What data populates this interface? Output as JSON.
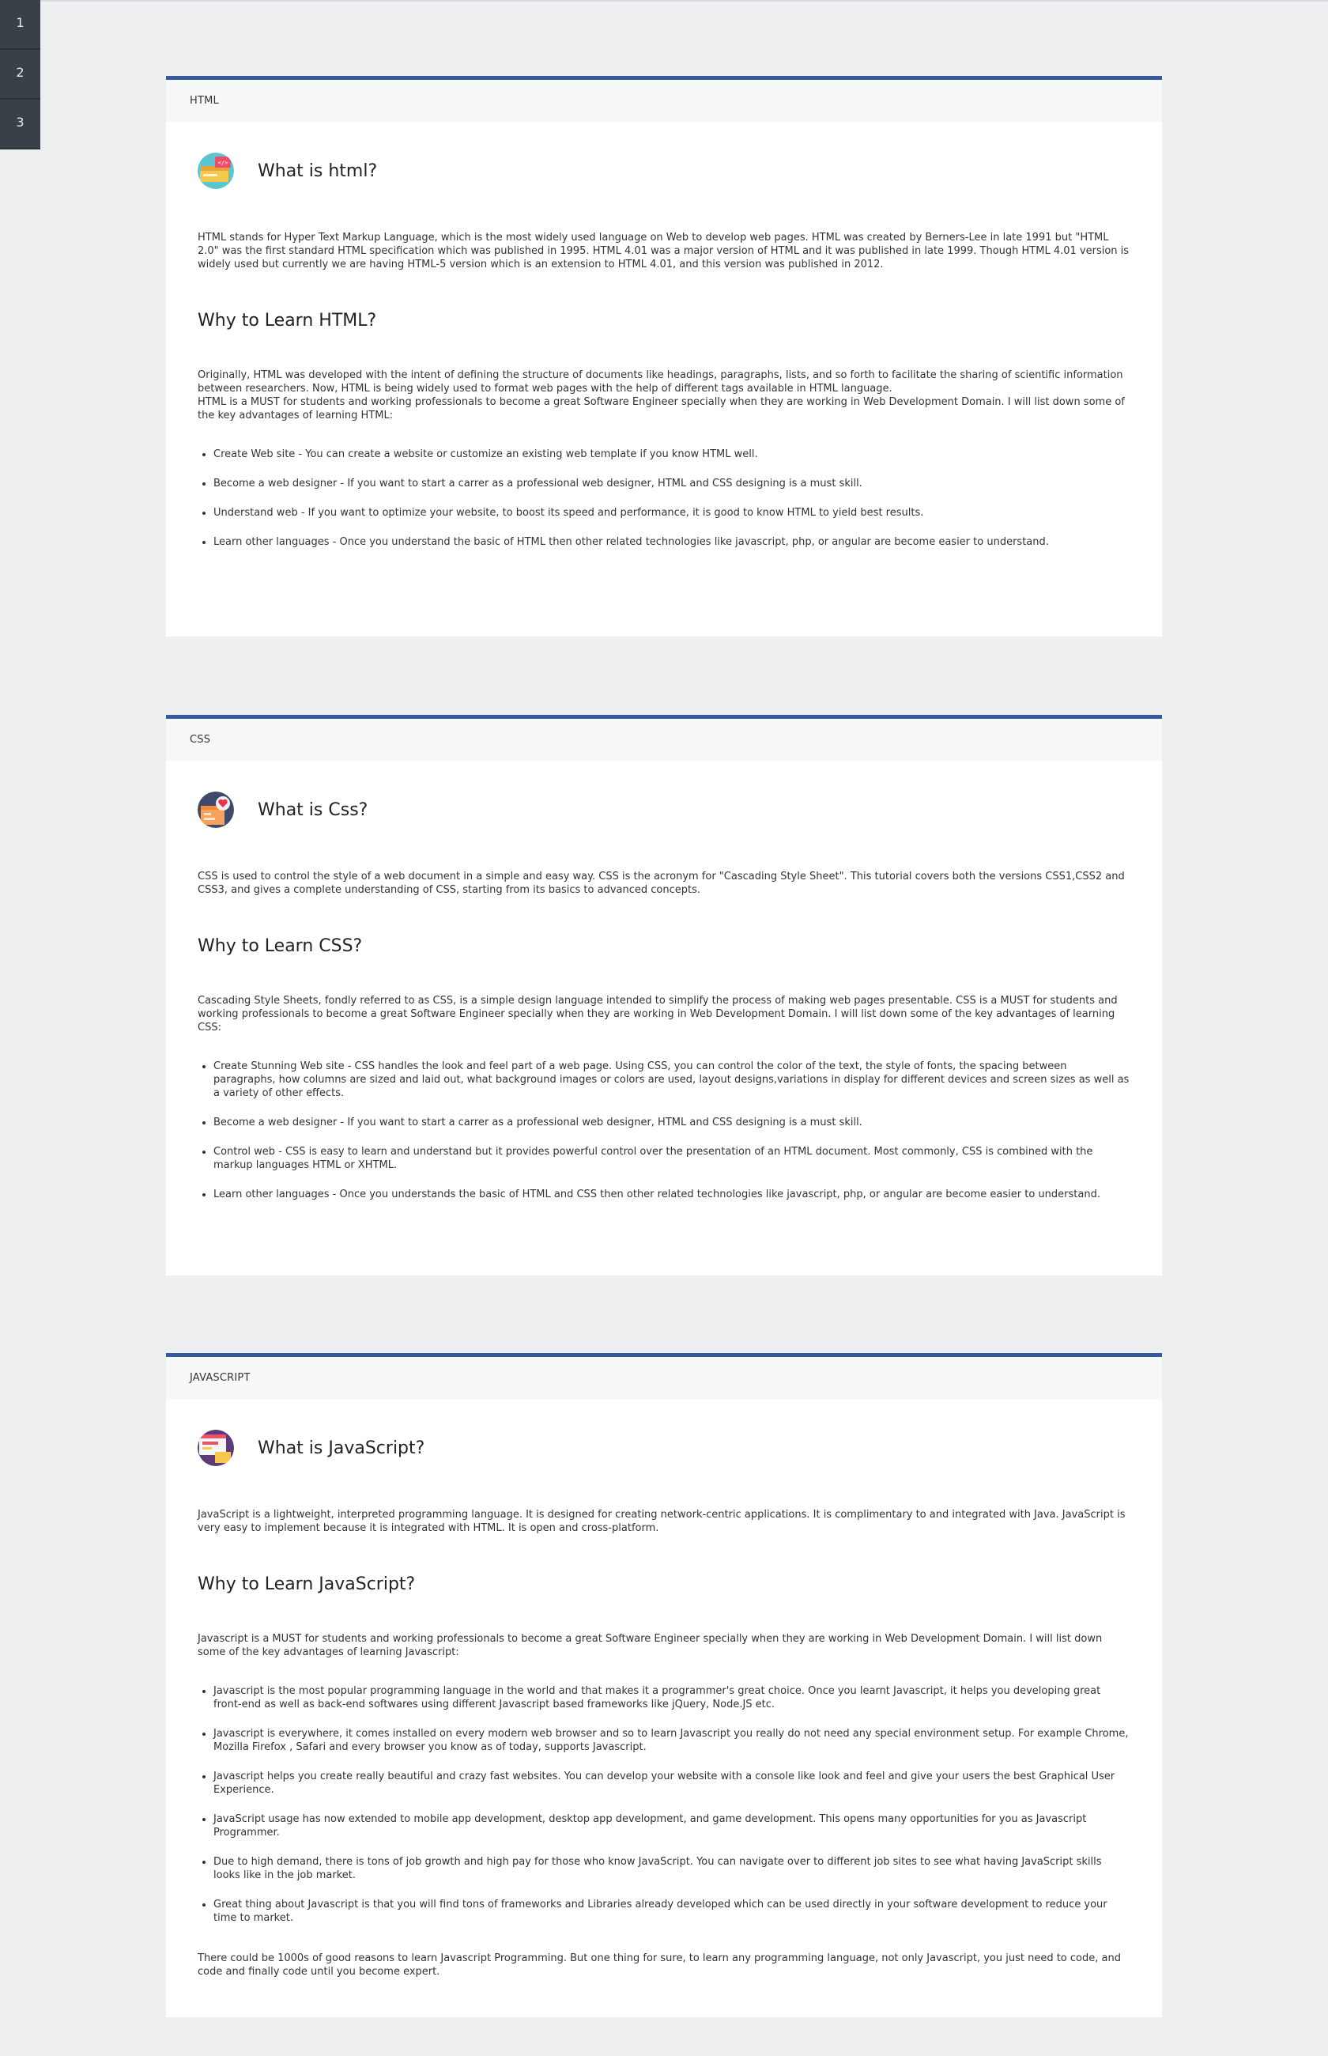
{
  "sidenav": {
    "items": [
      "1",
      "2",
      "3"
    ]
  },
  "sections": [
    {
      "header": "HTML",
      "what_title": "What is html?",
      "what_text": "HTML stands for Hyper Text Markup Language, which is the most widely used language on Web to develop web pages. HTML was created by Berners-Lee in late 1991 but \"HTML 2.0\" was the first standard HTML specification which was published in 1995. HTML 4.01 was a major version of HTML and it was published in late 1999. Though HTML 4.01 version is widely used but currently we are having HTML-5 version which is an extension to HTML 4.01, and this version was published in 2012.",
      "why_title": "Why to Learn HTML?",
      "why_intro": "Originally, HTML was developed with the intent of defining the structure of documents like headings, paragraphs, lists, and so forth to facilitate the sharing of scientific information between researchers. Now, HTML is being widely used to format web pages with the help of different tags available in HTML language.",
      "why_intro2": "HTML is a MUST for students and working professionals to become a great Software Engineer specially when they are working in Web Development Domain. I will list down some of the key advantages of learning HTML:",
      "points": [
        "Create Web site - You can create a website or customize an existing web template if you know HTML well.",
        "Become a web designer - If you want to start a carrer as a professional web designer, HTML and CSS designing is a must skill.",
        "Understand web - If you want to optimize your website, to boost its speed and performance, it is good to know HTML to yield best results.",
        "Learn other languages - Once you understand the basic of HTML then other related technologies like javascript, php, or angular are become easier to understand."
      ],
      "logo_icon": "html-logo-icon"
    },
    {
      "header": "CSS",
      "what_title": "What is Css?",
      "what_text": "CSS is used to control the style of a web document in a simple and easy way. CSS is the acronym for \"Cascading Style Sheet\". This tutorial covers both the versions CSS1,CSS2 and CSS3, and gives a complete understanding of CSS, starting from its basics to advanced concepts.",
      "why_title": "Why to Learn CSS?",
      "why_intro": "Cascading Style Sheets, fondly referred to as CSS, is a simple design language intended to simplify the process of making web pages presentable. CSS is a MUST for students and working professionals to become a great Software Engineer specially when they are working in Web Development Domain. I will list down some of the key advantages of learning CSS:",
      "points": [
        "Create Stunning Web site - CSS handles the look and feel part of a web page. Using CSS, you can control the color of the text, the style of fonts, the spacing between paragraphs, how columns are sized and laid out, what background images or colors are used, layout designs,variations in display for different devices and screen sizes as well as a variety of other effects.",
        "Become a web designer - If you want to start a carrer as a professional web designer, HTML and CSS designing is a must skill.",
        "Control web - CSS is easy to learn and understand but it provides powerful control over the presentation of an HTML document. Most commonly, CSS is combined with the markup languages HTML or XHTML.",
        "Learn other languages - Once you understands the basic of HTML and CSS then other related technologies like javascript, php, or angular are become easier to understand."
      ],
      "logo_icon": "css-logo-icon"
    },
    {
      "header": "JAVASCRIPT",
      "what_title": "What is JavaScript?",
      "what_text": "JavaScript is a lightweight, interpreted programming language. It is designed for creating network-centric applications. It is complimentary to and integrated with Java. JavaScript is very easy to implement because it is integrated with HTML. It is open and cross-platform.",
      "why_title": "Why to Learn JavaScript?",
      "why_intro": "Javascript is a MUST for students and working professionals to become a great Software Engineer specially when they are working in Web Development Domain. I will list down some of the key advantages of learning Javascript:",
      "points": [
        "Javascript is the most popular programming language in the world and that makes it a programmer's great choice. Once you learnt Javascript, it helps you developing great front-end as well as back-end softwares using different Javascript based frameworks like jQuery, Node.JS etc.",
        "Javascript is everywhere, it comes installed on every modern web browser and so to learn Javascript you really do not need any special environment setup. For example Chrome, Mozilla Firefox , Safari and every browser you know as of today, supports Javascript.",
        "Javascript helps you create really beautiful and crazy fast websites. You can develop your website with a console like look and feel and give your users the best Graphical User Experience.",
        "JavaScript usage has now extended to mobile app development, desktop app development, and game development. This opens many opportunities for you as Javascript Programmer.",
        "Due to high demand, there is tons of job growth and high pay for those who know JavaScript. You can navigate over to different job sites to see what having JavaScript skills looks like in the job market.",
        "Great thing about Javascript is that you will find tons of frameworks and Libraries already developed which can be used directly in your software development to reduce your time to market."
      ],
      "closing": "There could be 1000s of good reasons to learn Javascript Programming. But one thing for sure, to learn any programming language, not only Javascript, you just need to code, and code and finally code until you become expert.",
      "logo_icon": "js-logo-icon"
    }
  ],
  "colors": {
    "accent": "#36589c",
    "sidenav_bg": "#3a4047",
    "page_bg": "#eeeff1"
  }
}
